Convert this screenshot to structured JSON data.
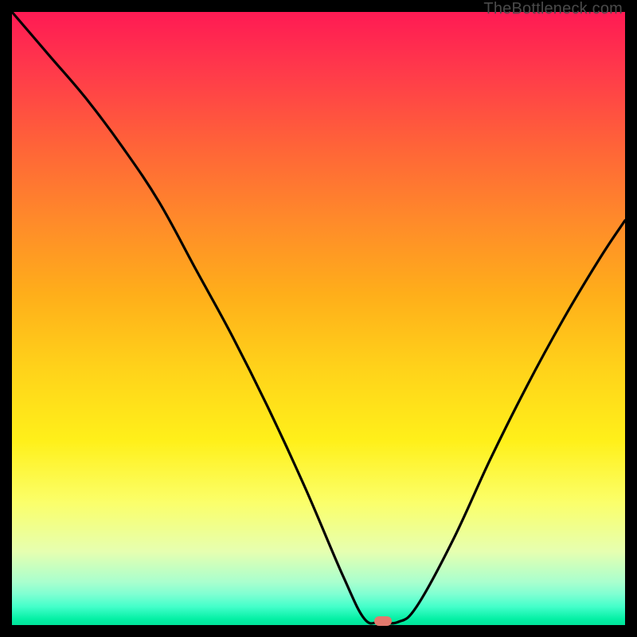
{
  "watermark": "TheBottleneck.com",
  "colors": {
    "frame": "#000000",
    "curve": "#000000",
    "marker": "#e2796d"
  },
  "chart_data": {
    "type": "line",
    "title": "",
    "xlabel": "",
    "ylabel": "",
    "xlim": [
      0,
      100
    ],
    "ylim": [
      0,
      100
    ],
    "grid": false,
    "series": [
      {
        "name": "bottleneck-curve",
        "x": [
          0,
          6,
          12,
          18,
          24,
          30,
          36,
          42,
          48,
          54,
          57.5,
          60,
          63,
          66,
          72,
          78,
          84,
          90,
          96,
          100
        ],
        "values": [
          100,
          93,
          86,
          78,
          69,
          58,
          47,
          35,
          22,
          8,
          1,
          0.5,
          0.5,
          3,
          14,
          27,
          39,
          50,
          60,
          66
        ]
      }
    ],
    "marker": {
      "x": 60.5,
      "y": 0.6
    },
    "background_gradient": {
      "top": "#ff1a54",
      "mid": "#ffe01a",
      "bottom": "#00e39a"
    }
  }
}
